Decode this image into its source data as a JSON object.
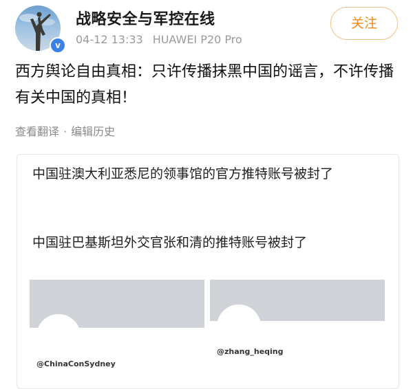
{
  "header": {
    "username": "战略安全与军控在线",
    "timestamp": "04-12 13:33",
    "device": "HUAWEI P20 Pro",
    "follow_label": "关注",
    "verified_icon": "v"
  },
  "post": {
    "text": "西方舆论自由真相：只许传播抹黑中国的谣言，不许传播有关中国的真相！",
    "actions": {
      "translate": "查看翻译",
      "separator": "·",
      "edit_history": "编辑历史"
    }
  },
  "embed": {
    "line1": "中国驻澳大利亚悉尼的领事馆的官方推特账号被封了",
    "line2": "中国驻巴基斯坦外交官张和清的推特账号被封了",
    "cards": [
      {
        "handle": "@ChinaConSydney"
      },
      {
        "handle": "@zhang_heqing"
      }
    ]
  },
  "colors": {
    "accent": "#f08a19",
    "verified": "#3a82e8",
    "banner_gray": "#cfd2d6"
  }
}
